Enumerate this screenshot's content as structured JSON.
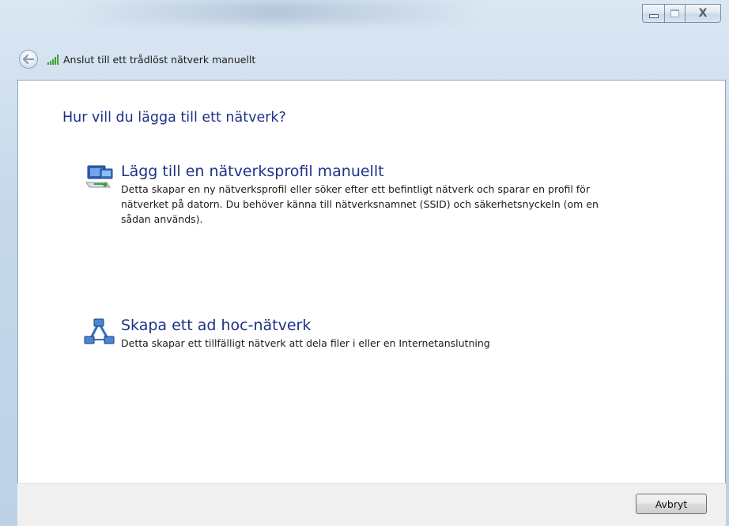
{
  "window": {
    "title": "Anslut till ett trådlöst nätverk manuellt",
    "controls": {
      "minimize_icon": "minimize-icon",
      "maximize_icon": "maximize-icon",
      "close_symbol": "X"
    }
  },
  "nav": {
    "back_icon": "back-arrow-icon",
    "network_icon": "wifi-signal-icon"
  },
  "main": {
    "heading": "Hur vill du lägga till ett nätverk?",
    "options": [
      {
        "icon": "network-profile-icon",
        "title": "Lägg till en nätverksprofil manuellt",
        "description": "Detta skapar en ny nätverksprofil eller söker efter ett befintligt nätverk och sparar en profil för nätverket på datorn. Du behöver känna till nätverksnamnet (SSID) och säkerhetsnyckeln (om en sådan används)."
      },
      {
        "icon": "ad-hoc-network-icon",
        "title": "Skapa ett ad hoc-nätverk",
        "description": "Detta skapar ett tillfälligt nätverk att dela filer i eller en Internetanslutning"
      }
    ]
  },
  "footer": {
    "cancel_label": "Avbryt"
  },
  "colors": {
    "accent": "#1e3287",
    "wifi": "#3aa22c"
  }
}
